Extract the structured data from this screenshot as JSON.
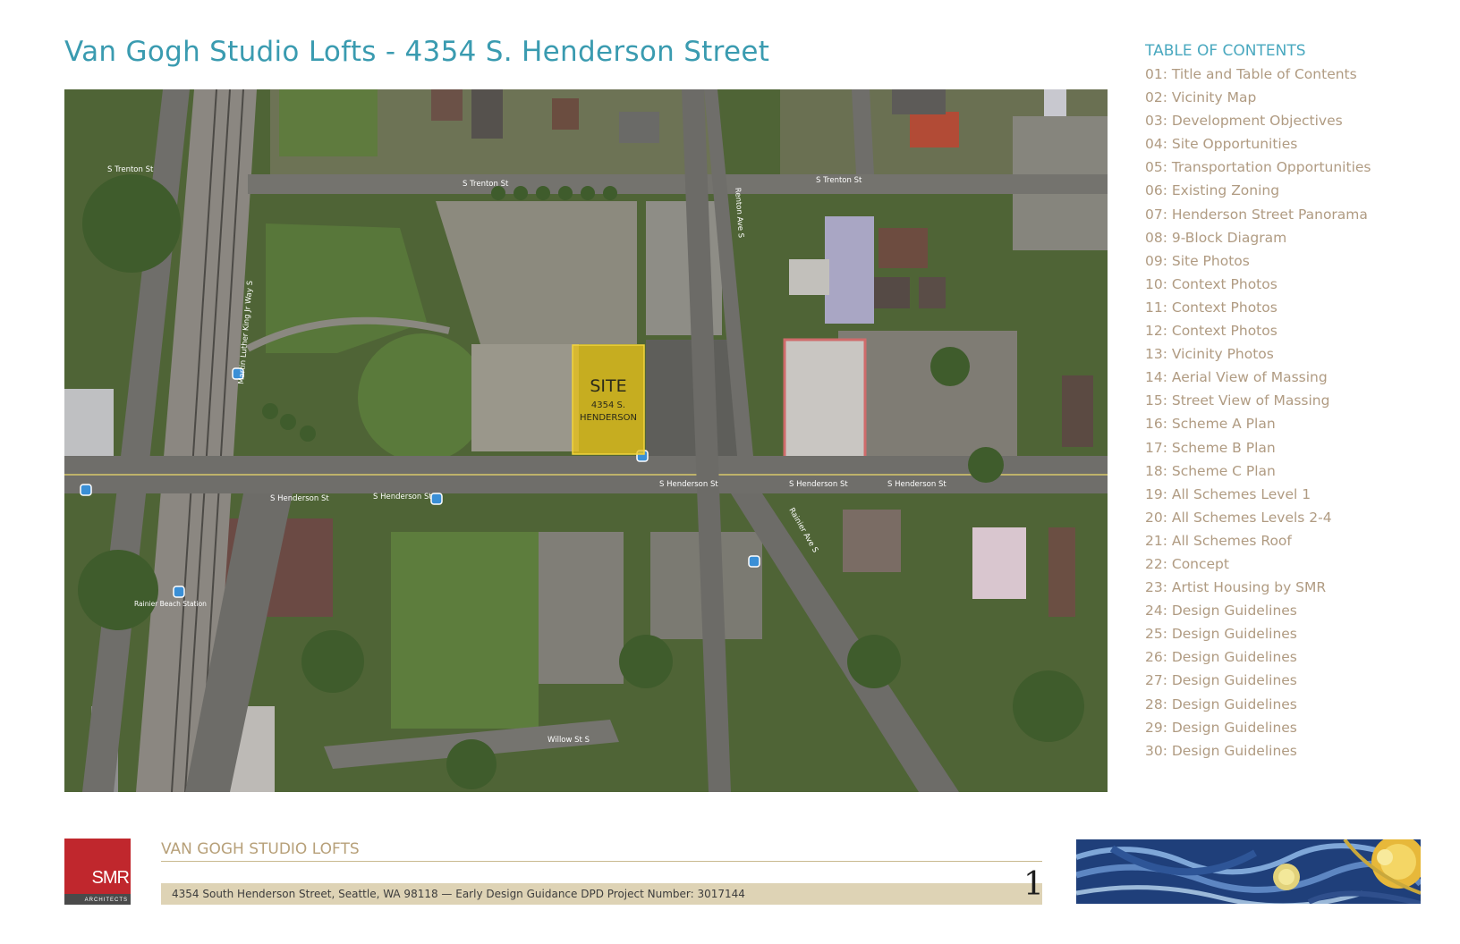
{
  "header": {
    "title": "Van Gogh Studio Lofts - 4354 S. Henderson Street"
  },
  "map": {
    "site_label": "SITE",
    "site_address_line1": "4354 S.",
    "site_address_line2": "HENDERSON",
    "streets": {
      "trenton_west": "S Trenton St",
      "trenton_mid": "S Trenton St",
      "trenton_east": "S Trenton St",
      "henderson_west": "S Henderson St",
      "henderson_mid": "S Henderson St",
      "henderson_center": "S Henderson St",
      "henderson_east_a": "S Henderson St",
      "henderson_east_b": "S Henderson St",
      "mlk_way": "Martin Luther King Jr Way S",
      "renton_ave": "Renton Ave S",
      "rainier_ave": "Rainier Ave S",
      "willow": "Willow St S",
      "station": "Rainier Beach Station"
    },
    "colors": {
      "site_fill": "#e8c21a",
      "vegetation": "#4f6436",
      "road": "#6f6e6a",
      "transit_marker": "#3a8fd6"
    }
  },
  "toc": {
    "heading": "TABLE OF CONTENTS",
    "items": [
      "01: Title and Table of Contents",
      "02: Vicinity Map",
      "03: Development Objectives",
      "04: Site Opportunities",
      "05: Transportation Opportunities",
      "06: Existing Zoning",
      "07: Henderson Street Panorama",
      "08: 9-Block Diagram",
      "09: Site Photos",
      "10: Context Photos",
      "11: Context Photos",
      "12: Context Photos",
      "13: Vicinity Photos",
      "14: Aerial View of Massing",
      "15: Street View of Massing",
      "16: Scheme A Plan",
      "17: Scheme B Plan",
      "18: Scheme C Plan",
      "19: All Schemes Level 1",
      "20: All Schemes Levels 2-4",
      "21: All Schemes Roof",
      "22: Concept",
      "23: Artist Housing by SMR",
      "24: Design Guidelines",
      "25: Design Guidelines",
      "26: Design Guidelines",
      "27: Design Guidelines",
      "28: Design Guidelines",
      "29: Design Guidelines",
      "30: Design Guidelines"
    ]
  },
  "footer": {
    "logo_text": "SMR",
    "logo_subtext": "ARCHITECTS",
    "project_name": "VAN GOGH STUDIO LOFTS",
    "address_line": "4354 South Henderson Street, Seattle, WA 98118 — Early Design Guidance   DPD Project Number: 3017144",
    "page_number": "1",
    "colors": {
      "logo_red": "#c0272d",
      "band": "#ded3b5",
      "title_blue": "#3a9bb0",
      "toc_tan": "#b09b82"
    }
  }
}
